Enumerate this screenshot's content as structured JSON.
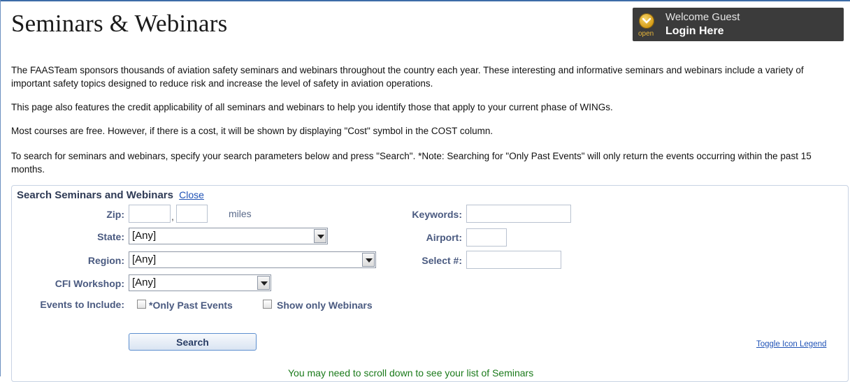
{
  "header": {
    "title": "Seminars & Webinars"
  },
  "login": {
    "welcome": "Welcome Guest",
    "link_label": "Login Here",
    "icon_caption": "open"
  },
  "intro": {
    "p1": "The FAASTeam sponsors thousands of aviation safety seminars and webinars throughout the country each year. These interesting and informative seminars and webinars include a variety of important safety topics designed to reduce risk and increase the level of safety in aviation operations.",
    "p2": "This page also features the credit applicability of all seminars and webinars to help you identify those that apply to your current phase of WINGs.",
    "p3": "Most courses are free. However, if there is a cost, it will be shown by displaying \"Cost\" symbol in the COST column.",
    "p4": "To search for seminars and webinars, specify your search parameters below and press \"Search\". *Note: Searching for \"Only Past Events\" will only return the events occurring within the past 15 months."
  },
  "search": {
    "panel_title": "Search Seminars and Webinars",
    "close_label": "Close",
    "zip_label": "Zip:",
    "zip_value": "",
    "miles_value": "",
    "comma": ",",
    "miles_label": "miles",
    "state_label": "State:",
    "state_value": "[Any]",
    "region_label": "Region:",
    "region_value": "[Any]",
    "cfi_label": "CFI Workshop:",
    "cfi_value": "[Any]",
    "keywords_label": "Keywords:",
    "keywords_value": "",
    "airport_label": "Airport:",
    "airport_value": "",
    "select_label": "Select #:",
    "select_value": "",
    "events_label": "Events to Include:",
    "past_events_label": "*Only Past Events",
    "webinars_label": "Show only Webinars",
    "button_label": "Search",
    "toggle_legend": "Toggle Icon Legend",
    "scroll_note": "You may need to scroll down to see your list of Seminars"
  },
  "colors": {
    "label_text": "#4a5a80",
    "link": "#1f52b6",
    "note_green": "#1a7a1a",
    "login_bg": "#3b3b3b"
  },
  "icons": {
    "login": "open-chevron-icon",
    "dropdown": "chevron-down-icon"
  }
}
